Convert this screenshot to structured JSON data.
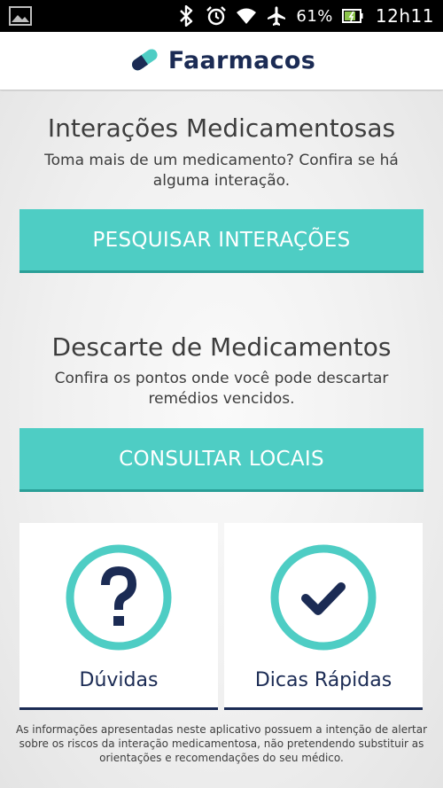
{
  "status_bar": {
    "battery_percent": "61%",
    "time": "12h11",
    "icons": [
      "image-icon",
      "bluetooth-icon",
      "alarm-icon",
      "wifi-icon",
      "airplane-icon",
      "battery-icon"
    ]
  },
  "app": {
    "name": "Faarmacos",
    "logo": "pill-heart-logo",
    "colors": {
      "accent": "#4ecdc4",
      "brand": "#1b2b54"
    }
  },
  "interactions": {
    "title": "Interações Medicamentosas",
    "subtitle": "Toma mais de um medicamento? Confira se há alguma interação.",
    "button_label": "PESQUISAR INTERAÇÕES"
  },
  "disposal": {
    "title": "Descarte de Medicamentos",
    "subtitle": "Confira os pontos onde você pode descartar remédios vencidos.",
    "button_label": "CONSULTAR LOCAIS"
  },
  "cards": [
    {
      "label": "Dúvidas",
      "icon": "question-circle-icon"
    },
    {
      "label": "Dicas Rápidas",
      "icon": "check-circle-icon"
    }
  ],
  "disclaimer": "As informações apresentadas neste aplicativo possuem a intenção de alertar sobre os riscos da interação medicamentosa, não pretendendo substituir as orientações e recomendações do seu médico."
}
